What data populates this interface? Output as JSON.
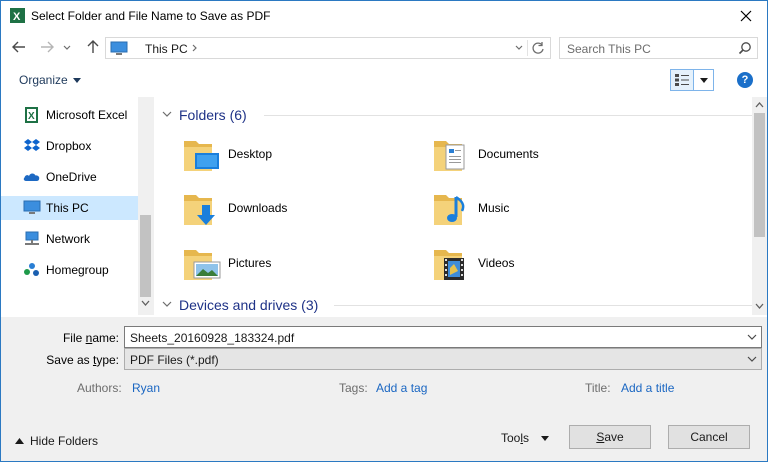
{
  "window": {
    "title": "Select Folder and File Name to Save as PDF",
    "close_glyph": "✕"
  },
  "nav": {
    "address": "This PC",
    "search_placeholder": "Search This PC"
  },
  "toolbar": {
    "organize_label": "Organize",
    "help_glyph": "?"
  },
  "sidebar": {
    "items": [
      {
        "label": "Microsoft Excel",
        "icon": "excel-icon"
      },
      {
        "label": "Dropbox",
        "icon": "dropbox-icon"
      },
      {
        "label": "OneDrive",
        "icon": "onedrive-icon"
      },
      {
        "label": "This PC",
        "icon": "this-pc-icon",
        "selected": true
      },
      {
        "label": "Network",
        "icon": "network-icon"
      },
      {
        "label": "Homegroup",
        "icon": "homegroup-icon"
      }
    ]
  },
  "content": {
    "folders_header": "Folders (6)",
    "folders": [
      {
        "label": "Desktop",
        "icon": "desktop-folder-icon"
      },
      {
        "label": "Documents",
        "icon": "documents-folder-icon"
      },
      {
        "label": "Downloads",
        "icon": "downloads-folder-icon"
      },
      {
        "label": "Music",
        "icon": "music-folder-icon"
      },
      {
        "label": "Pictures",
        "icon": "pictures-folder-icon"
      },
      {
        "label": "Videos",
        "icon": "videos-folder-icon"
      }
    ],
    "devices_header": "Devices and drives (3)"
  },
  "form": {
    "file_name_label_pre": "File ",
    "file_name_label_u": "n",
    "file_name_label_post": "ame:",
    "file_name_value": "Sheets_20160928_183324.pdf",
    "save_type_label_pre": "Save as ",
    "save_type_label_u": "t",
    "save_type_label_post": "ype:",
    "save_type_value": "PDF Files (*.pdf)",
    "authors_label": "Authors:",
    "authors_value": "Ryan",
    "tags_label": "Tags:",
    "tags_value": "Add a tag",
    "title_label": "Title:",
    "title_value": "Add a title"
  },
  "footer": {
    "hide_folders_label": "Hide Folders",
    "tools_label_pre": "Too",
    "tools_label_u": "l",
    "tools_label_post": "s",
    "save_label_u": "S",
    "save_label_post": "ave",
    "cancel_label": "Cancel"
  },
  "colors": {
    "accent": "#1a6fc9",
    "link": "#1a66c2",
    "group_header": "#1e3287",
    "selection": "#cce8ff",
    "folder": "#f4d27a",
    "panel": "#f0f0f0"
  }
}
